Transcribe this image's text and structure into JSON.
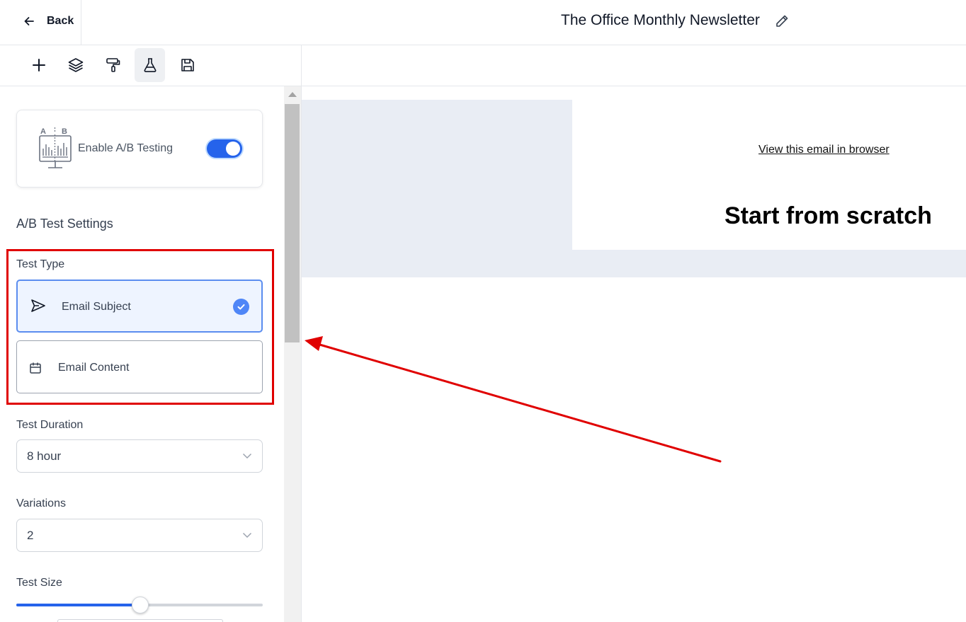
{
  "header": {
    "back_label": "Back",
    "title": "The Office Monthly Newsletter"
  },
  "toolbar": {
    "tools": [
      "add-icon",
      "layers-icon",
      "paint-roller-icon",
      "flask-icon",
      "save-icon"
    ],
    "active_tool": "flask-icon"
  },
  "sidebar": {
    "ab_toggle": {
      "icon_text_a": "A",
      "icon_text_b": "B",
      "label": "Enable A/B Testing",
      "enabled": true
    },
    "settings_title": "A/B Test Settings",
    "test_type": {
      "label": "Test Type",
      "options": [
        {
          "label": "Email Subject",
          "icon": "send-icon",
          "selected": true
        },
        {
          "label": "Email Content",
          "icon": "calendar-icon",
          "selected": false
        }
      ]
    },
    "test_duration": {
      "label": "Test Duration",
      "value": "8 hour"
    },
    "variations": {
      "label": "Variations",
      "value": "2"
    },
    "test_size": {
      "label": "Test Size",
      "value_fraction": 0.5
    }
  },
  "canvas": {
    "view_in_browser": "View this email in browser",
    "headline": "Start from scratch"
  },
  "colors": {
    "accent": "#2563eb",
    "annotation_red": "#e00000",
    "canvas_band": "#e9edf4"
  }
}
